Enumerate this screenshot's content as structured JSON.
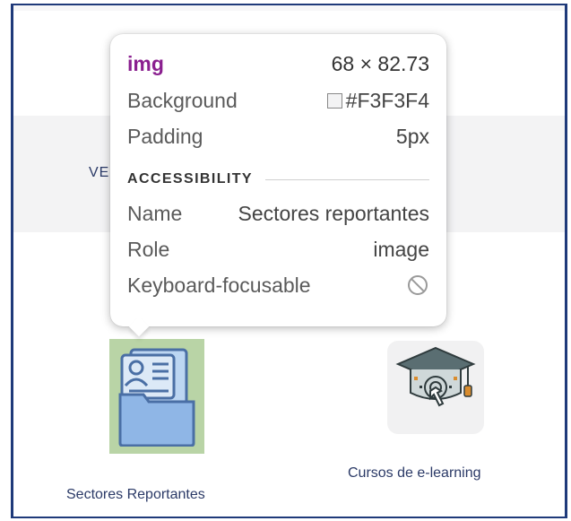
{
  "tooltip": {
    "tag": "img",
    "dimensions": "68 × 82.73",
    "background_label": "Background",
    "background_value": "#F3F3F4",
    "padding_label": "Padding",
    "padding_value": "5px",
    "section_title": "ACCESSIBILITY",
    "name_label": "Name",
    "name_value": "Sectores reportantes",
    "role_label": "Role",
    "role_value": "image",
    "keyboard_label": "Keyboard-focusable"
  },
  "page": {
    "band_link": "VE",
    "caption_sectores": "Sectores Reportantes",
    "caption_elearning": "Cursos de e-learning"
  },
  "colors": {
    "tag": "#8a1f8f",
    "highlight": "#b9d4a6",
    "frame": "#1f3a7a",
    "link": "#2b3a67"
  }
}
